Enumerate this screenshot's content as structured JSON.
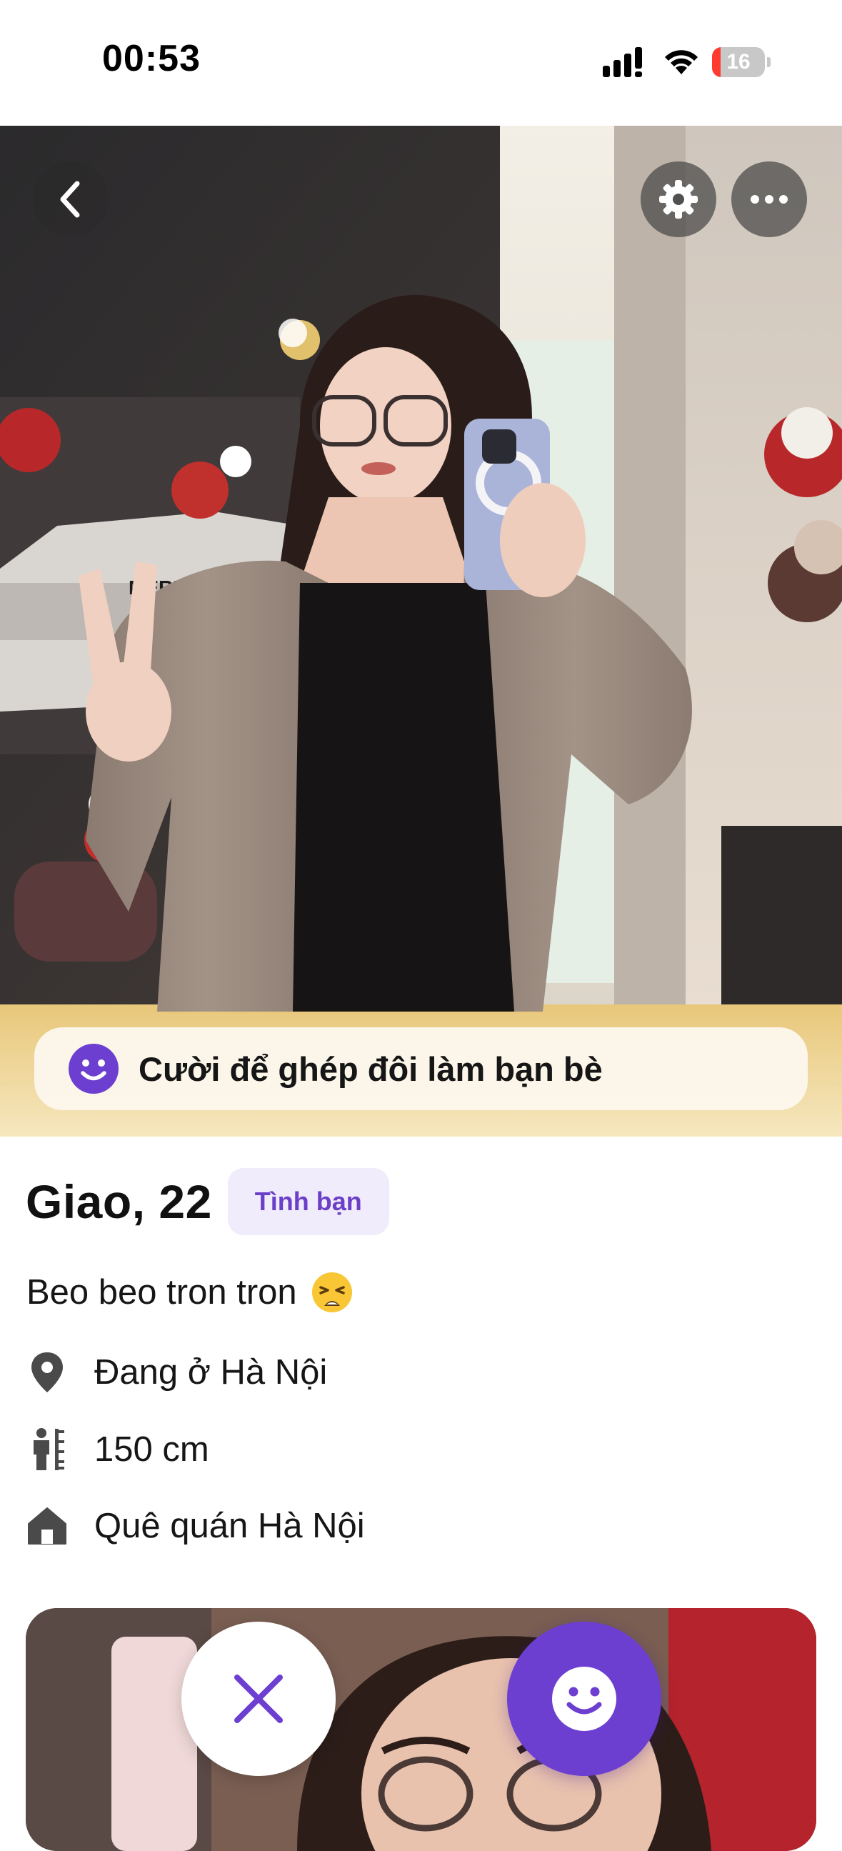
{
  "status_bar": {
    "time": "00:53",
    "battery_level": "16",
    "battery_fraction": 0.16
  },
  "hero": {
    "back_icon": "chevron-left-icon",
    "settings_icon": "gear-icon",
    "more_icon": "ellipsis-icon",
    "smile_banner_text": "Cười để ghép đôi làm bạn bè"
  },
  "profile": {
    "name_age": "Giao, 22",
    "intent_badge": "Tình bạn",
    "bio": "Beo beo tron tron",
    "bio_emoji": "weary-face-emoji",
    "location": "Đang ở Hà Nội",
    "height": "150 cm",
    "hometown": "Quê quán Hà Nội"
  },
  "actions": {
    "pass_icon": "close-icon",
    "like_icon": "smile-icon"
  },
  "colors": {
    "accent": "#6c3fd1",
    "badge_bg": "#f1ecfb",
    "badge_text": "#6b3fc8",
    "icon_gray": "#4a4a4a"
  }
}
